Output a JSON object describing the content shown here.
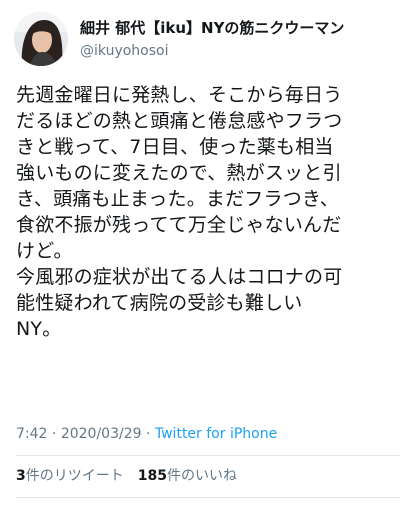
{
  "author": {
    "display_name": "細井 郁代【iku】NYの筋ニクウーマン",
    "handle": "@ikuyohosoi"
  },
  "tweet": {
    "lines": [
      "先週金曜日に発熱し、そこから毎日う",
      "だるほどの熱と頭痛と倦怠感やフラつ",
      "きと戦って、7日目、使った薬も相当",
      "強いものに変えたので、熱がスッと引",
      "き、頭痛も止まった。まだフラつき、",
      "食欲不振が残ってて万全じゃないんだ",
      "けど。",
      "今風邪の症状が出てる人はコロナの可",
      "能性疑われて病院の受診も難しい",
      "NY。"
    ]
  },
  "meta": {
    "time": "7:42",
    "separator": "·",
    "date": "2020/03/29",
    "source": "Twitter for iPhone"
  },
  "stats": {
    "retweets_count": "3",
    "retweets_label": "件のリツイート",
    "likes_count": "185",
    "likes_label": "件のいいね"
  },
  "colors": {
    "text": "#14171a",
    "secondary": "#657786",
    "link": "#1da1f2",
    "divider": "#e1e8ed"
  }
}
